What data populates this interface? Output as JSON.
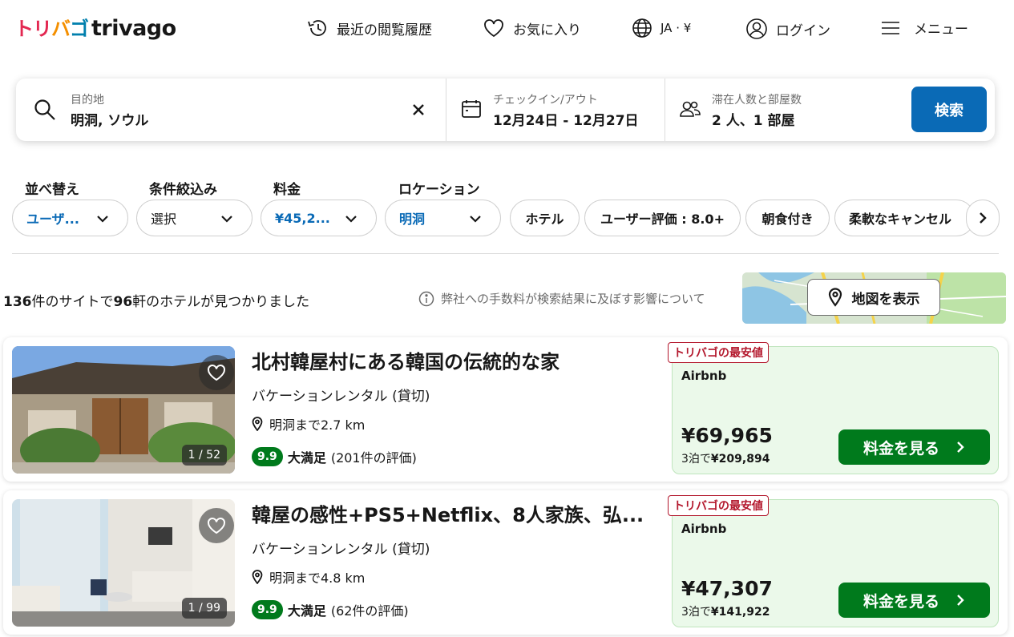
{
  "header": {
    "logo_jp": "トリバゴ",
    "logo_en": "trivago",
    "nav": {
      "history": "最近の閲覧履歴",
      "favorites": "お気に入り",
      "locale": "JA · ¥",
      "login": "ログイン",
      "menu": "メニュー"
    }
  },
  "search": {
    "destination_label": "目的地",
    "destination_value": "明洞, ソウル",
    "dates_label": "チェックイン/アウト",
    "dates_value": "12月24日 - 12月27日",
    "guests_label": "滞在人数と部屋数",
    "guests_value": "2 人、1 部屋",
    "search_button": "検索"
  },
  "filters": {
    "sort": {
      "title": "並べ替え",
      "value": "ユーザ..."
    },
    "conditions": {
      "title": "条件絞込み",
      "value": "選択"
    },
    "price": {
      "title": "料金",
      "value": "¥45,2..."
    },
    "location": {
      "title": "ロケーション",
      "value": "明洞"
    },
    "chips": [
      "ホテル",
      "ユーザー評価 : 8.0+",
      "朝食付き",
      "柔軟なキャンセル"
    ]
  },
  "results": {
    "count_sites": "136",
    "count_sites_suffix": "件のサイトで",
    "count_hotels": "96",
    "count_hotels_suffix": "軒のホテルが見つかりました",
    "fee_note": "弊社への手数料が検索結果に及ぼす影響について",
    "map_button": "地図を表示"
  },
  "listings": [
    {
      "title": "北村韓屋村にある韓国の伝統的な家",
      "type": "バケーションレンタル (貸切)",
      "distance": "明洞まで2.7 km",
      "score": "9.9",
      "rating_label": "大満足",
      "reviews": "(201件の評価)",
      "photo_counter": "1 / 52",
      "deal_tag": "トリバゴの最安値",
      "site": "Airbnb",
      "price": "¥69,965",
      "total_prefix": "3泊で",
      "total": "¥209,894",
      "cta": "料金を見る"
    },
    {
      "title": "韓屋の感性+PS5+Netflix、8人家族、弘...",
      "type": "バケーションレンタル (貸切)",
      "distance": "明洞まで4.8 km",
      "score": "9.9",
      "rating_label": "大満足",
      "reviews": "(62件の評価)",
      "photo_counter": "1 / 99",
      "deal_tag": "トリバゴの最安値",
      "site": "Airbnb",
      "price": "¥47,307",
      "total_prefix": "3泊で",
      "total": "¥141,922",
      "cta": "料金を見る"
    }
  ],
  "colors": {
    "brand_blue": "#0a6ab6",
    "deal_green": "#007a1c",
    "deal_bg": "#ebf9ea",
    "tag_red": "#b3172c",
    "logo_red": "#e32851",
    "logo_orange": "#f48f00",
    "logo_blue": "#007fad"
  }
}
